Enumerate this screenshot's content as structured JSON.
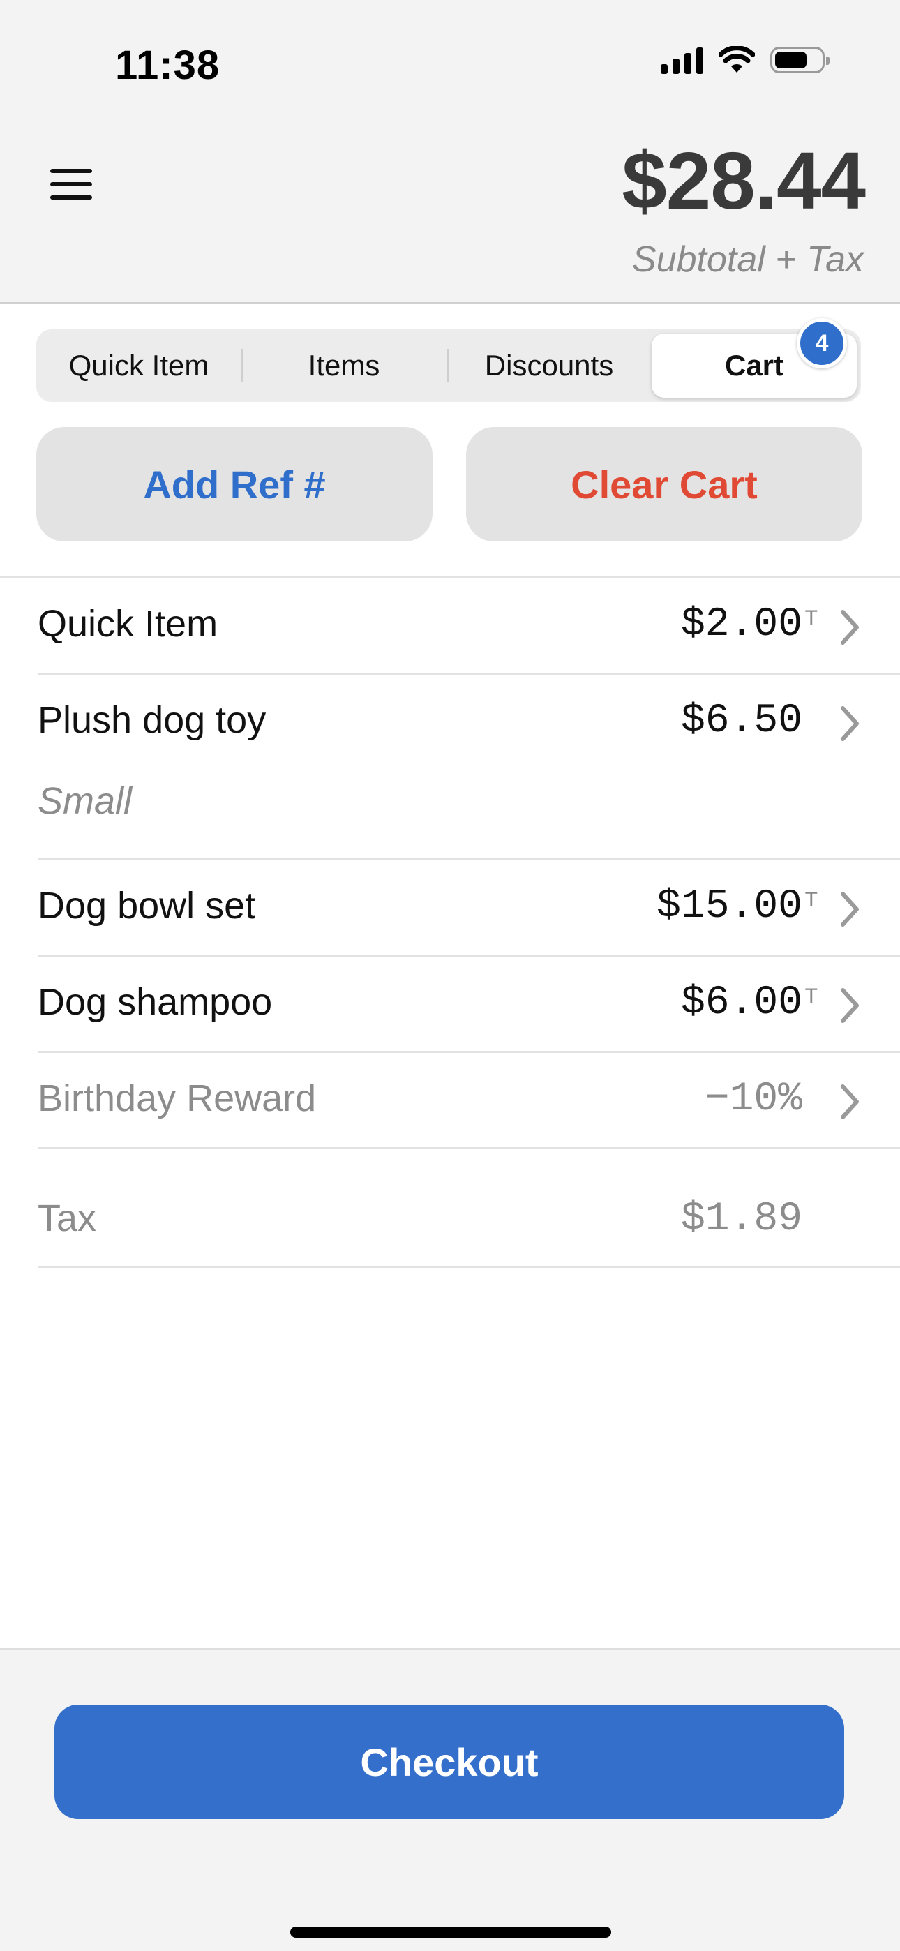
{
  "status_bar": {
    "time": "11:38"
  },
  "header": {
    "total": "$28.44",
    "subtitle": "Subtotal + Tax"
  },
  "tabs": [
    {
      "label": "Quick Item"
    },
    {
      "label": "Items"
    },
    {
      "label": "Discounts"
    },
    {
      "label": "Cart",
      "active": true,
      "badge": "4"
    }
  ],
  "actions": {
    "add_ref": "Add Ref #",
    "clear_cart": "Clear Cart"
  },
  "cart": [
    {
      "name": "Quick Item",
      "price": "$2.00",
      "tax_flag": "T"
    },
    {
      "name": "Plush dog toy",
      "price": "$6.50",
      "variant": "Small"
    },
    {
      "name": "Dog bowl set",
      "price": "$15.00",
      "tax_flag": "T"
    },
    {
      "name": "Dog shampoo",
      "price": "$6.00",
      "tax_flag": "T"
    },
    {
      "name": "Birthday Reward",
      "price": "−10%"
    }
  ],
  "tax": {
    "label": "Tax",
    "amount": "$1.89"
  },
  "checkout": {
    "label": "Checkout"
  },
  "colors": {
    "accent": "#336fcb",
    "destructive": "#e04a34",
    "muted_text": "#8c8c8c"
  }
}
